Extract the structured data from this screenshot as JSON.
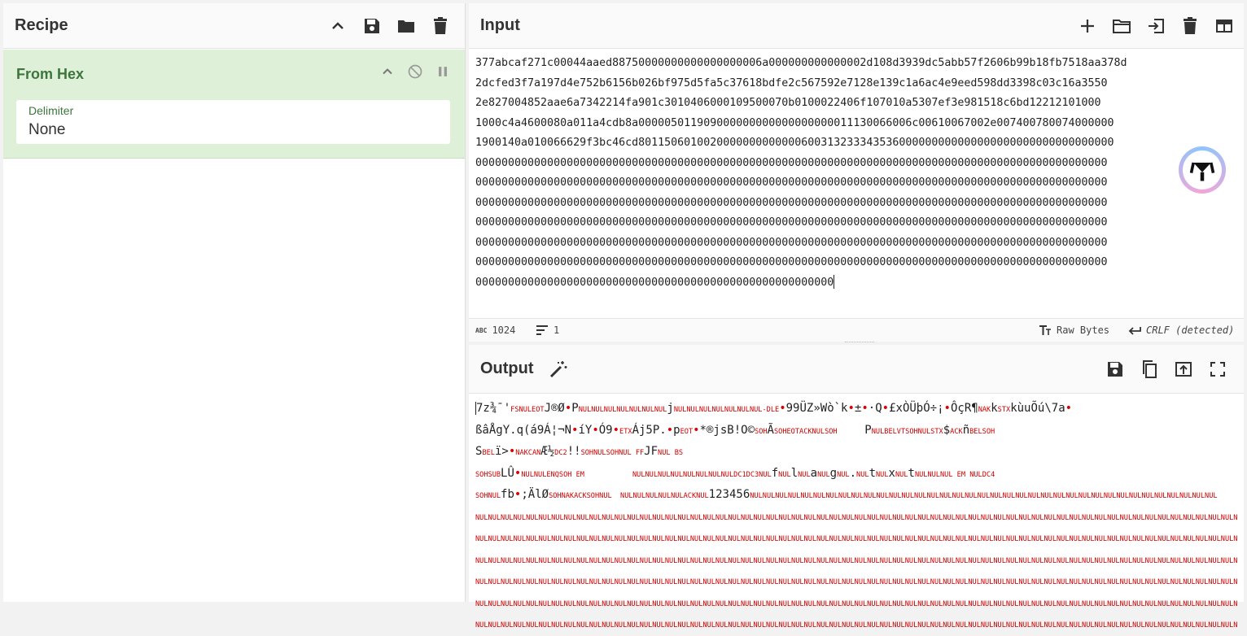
{
  "recipe": {
    "title": "Recipe",
    "icons": [
      "chevron-up-icon",
      "save-icon",
      "folder-icon",
      "trash-icon"
    ],
    "operation": {
      "name": "From Hex",
      "icons": [
        "chevron-up-icon",
        "disable-icon",
        "pause-icon"
      ],
      "delimiter_label": "Delimiter",
      "delimiter_value": "None"
    }
  },
  "input": {
    "title": "Input",
    "icons": [
      "plus-icon",
      "folder-icon",
      "import-icon",
      "trash-icon",
      "layout-icon"
    ],
    "lines": [
      "377abcaf271c00044aaed88750000000000000000006a000000000000002d108d3939dc5abb57f2606b99b18fb7518aa378d",
      "2dcfed3f7a197d4e752b6156b026bf975d5fa5c37618bdfe2c567592e7128e139c1a6ac4e9eed598dd3398c03c16a3550",
      "2e827004852aae6a7342214fa901c3010406000109500070b0100022406f107010a5307ef3e981518c6bd12212101000",
      "1000c4a4600080a011a4cdb8a000005011909000000000000000000011130066006c00610067002e007400780074000000",
      "1900140a010066629f3bc46cd8011506010020000000000000600313233343536000000000000000000000000000000000",
      "0000000000000000000000000000000000000000000000000000000000000000000000000000000000000000000000000",
      "0000000000000000000000000000000000000000000000000000000000000000000000000000000000000000000000000",
      "0000000000000000000000000000000000000000000000000000000000000000000000000000000000000000000000000",
      "0000000000000000000000000000000000000000000000000000000000000000000000000000000000000000000000000",
      "0000000000000000000000000000000000000000000000000000000000000000000000000000000000000000000000000",
      "0000000000000000000000000000000000000000000000000000000000000000000000000000000000000000000000000",
      "0000000000000000000000000000000000000000000000000000000"
    ],
    "status": {
      "length": "1024",
      "lines": "1",
      "encoding": "Raw Bytes",
      "eol": "CRLF (detected)"
    }
  },
  "output": {
    "title": "Output",
    "icons": [
      "magic-wand-icon",
      "save-icon",
      "copy-icon",
      "replace-input-icon",
      "maximize-icon"
    ],
    "lines": [
      [
        [
          "7z¾¯'"
        ],
        [
          "FS",
          "c"
        ],
        [
          "NULEOT",
          "c"
        ],
        [
          "J®Ø"
        ],
        [
          "•",
          "d"
        ],
        [
          "P"
        ],
        [
          "NULNULNULNULNULNULNUL",
          "c"
        ],
        [
          "j"
        ],
        [
          "NULNULNULNULNULNULNUL-DLE",
          "c"
        ],
        [
          "•",
          "d"
        ],
        [
          "99ÜZ»Wò`k"
        ],
        [
          "•",
          "d"
        ],
        [
          "±"
        ],
        [
          "•",
          "d"
        ],
        [
          "·Q"
        ],
        [
          "•",
          "d"
        ],
        [
          "£xÒÜþÓ÷¡"
        ],
        [
          "•",
          "d"
        ],
        [
          "ÔçR¶"
        ],
        [
          "NAK",
          "c"
        ],
        [
          "k"
        ],
        [
          "STX",
          "c"
        ],
        [
          "kùuÕú\\7a"
        ],
        [
          "•",
          "d"
        ]
      ],
      [
        [
          "ßâÅgY.q(á9Á¦¬N"
        ],
        [
          "•",
          "d"
        ],
        [
          "íY"
        ],
        [
          "•",
          "d"
        ],
        [
          "Ó9"
        ],
        [
          "•",
          "d"
        ],
        [
          "ETX",
          "c"
        ],
        [
          "Áj5P."
        ],
        [
          "•",
          "d"
        ],
        [
          "p"
        ],
        [
          "EOT",
          "c"
        ],
        [
          "•",
          "d"
        ],
        [
          "*®jsB!O©"
        ],
        [
          "SOH",
          "c"
        ],
        [
          "Ã"
        ],
        [
          "SOHEOTACKNULSOH",
          "c"
        ],
        [
          "    P"
        ],
        [
          "NULBELVTSOHNULSTX",
          "c"
        ],
        [
          "$"
        ],
        [
          "ACK",
          "c"
        ],
        [
          "ñ"
        ],
        [
          "BELSOH",
          "c"
        ]
      ],
      [
        [
          "S"
        ],
        [
          "BEL",
          "c"
        ],
        [
          "ï>"
        ],
        [
          "•",
          "d"
        ],
        [
          "NAKCAN",
          "c"
        ],
        [
          "Æ½"
        ],
        [
          "DC2",
          "c"
        ],
        [
          "!!"
        ],
        [
          "SOHNULSOHNUL FF",
          "c"
        ],
        [
          "JF"
        ],
        [
          "NUL BS",
          "c"
        ]
      ],
      [
        [
          "SOHSUB",
          "c"
        ],
        [
          "LÛ"
        ],
        [
          "•",
          "d"
        ],
        [
          "NULNULENQSOH EM",
          "c"
        ],
        [
          "       "
        ],
        [
          "NULNULNULNULNULNULNULNULDC1DC3NUL",
          "c"
        ],
        [
          "f"
        ],
        [
          "NUL",
          "c"
        ],
        [
          "l"
        ],
        [
          "NUL",
          "c"
        ],
        [
          "a"
        ],
        [
          "NUL",
          "c"
        ],
        [
          "g"
        ],
        [
          "NUL",
          "c"
        ],
        [
          "."
        ],
        [
          "NUL",
          "c"
        ],
        [
          "t"
        ],
        [
          "NUL",
          "c"
        ],
        [
          "x"
        ],
        [
          "NUL",
          "c"
        ],
        [
          "t"
        ],
        [
          "NULNULNUL EM NULDC4",
          "c"
        ]
      ],
      [
        [
          "SOHNUL",
          "c"
        ],
        [
          "fb"
        ],
        [
          "•",
          "d"
        ],
        [
          ";ÄlØ"
        ],
        [
          "SOHNAKACKSOHNUL  NULNULNULNULNULACKNUL",
          "c"
        ],
        [
          "123456"
        ],
        [
          "NULNULNULNULNULNULNULNULNULNULNULNULNULNULNULNULNULNULNULNULNULNULNULNULNULNULNULNULNULNULNULNULNULNULNULNULNUL",
          "c"
        ]
      ],
      [
        [
          "NULNULNULNULNULNULNULNULNULNULNULNULNULNULNULNULNULNULNULNULNULNULNULNULNULNULNULNULNULNULNULNULNULNULNULNULNULNULNULNULNULNULNULNULNULNULNULNULNULNULNULNULNULNULNULNULNULNULNULNULNULNULNULNULNULNULNULNULNUL",
          "c"
        ]
      ],
      [
        [
          "NULNULNULNULNULNULNULNULNULNULNULNULNULNULNULNULNULNULNULNULNULNULNULNULNULNULNULNULNULNULNULNULNULNULNULNULNULNULNULNULNULNULNULNULNULNULNULNULNULNULNULNULNULNULNULNULNULNULNULNULNULNULNULNULNULNULNULNULNUL",
          "c"
        ]
      ],
      [
        [
          "NULNULNULNULNULNULNULNULNULNULNULNULNULNULNULNULNULNULNULNULNULNULNULNULNULNULNULNULNULNULNULNULNULNULNULNULNULNULNULNULNULNULNULNULNULNULNULNULNULNULNULNULNULNULNULNULNULNULNULNULNULNULNULNULNULNULNULNULNUL",
          "c"
        ]
      ],
      [
        [
          "NULNULNULNULNULNULNULNULNULNULNULNULNULNULNULNULNULNULNULNULNULNULNULNULNULNULNULNULNULNULNULNULNULNULNULNULNULNULNULNULNULNULNULNULNULNULNULNULNULNULNULNULNULNULNULNULNULNULNULNULNULNULNULNULNULNULNULNULNUL",
          "c"
        ]
      ],
      [
        [
          "NULNULNULNULNULNULNULNULNULNULNULNULNULNULNULNULNULNULNULNULNULNULNULNULNULNULNULNULNULNULNULNULNULNULNULNULNULNULNULNULNULNULNULNULNULNULNULNULNULNULNULNULNULNULNULNULNULNULNULNULNULNULNULNULNULNULNULNULNUL",
          "c"
        ]
      ],
      [
        [
          "NULNULNULNULNULNULNULNULNULNULNULNULNULNULNULNULNULNULNULNULNULNULNULNULNULNULNULNULNULNULNULNULNULNULNULNULNULNULNULNULNULNULNULNULNULNULNULNULNULNULNULNULNULNULNULNULNULNULNULNULNULNULNULNULNULNULNUL",
          "c"
        ]
      ]
    ]
  },
  "logo": {
    "name": "cyberchef-logo-watermark"
  }
}
